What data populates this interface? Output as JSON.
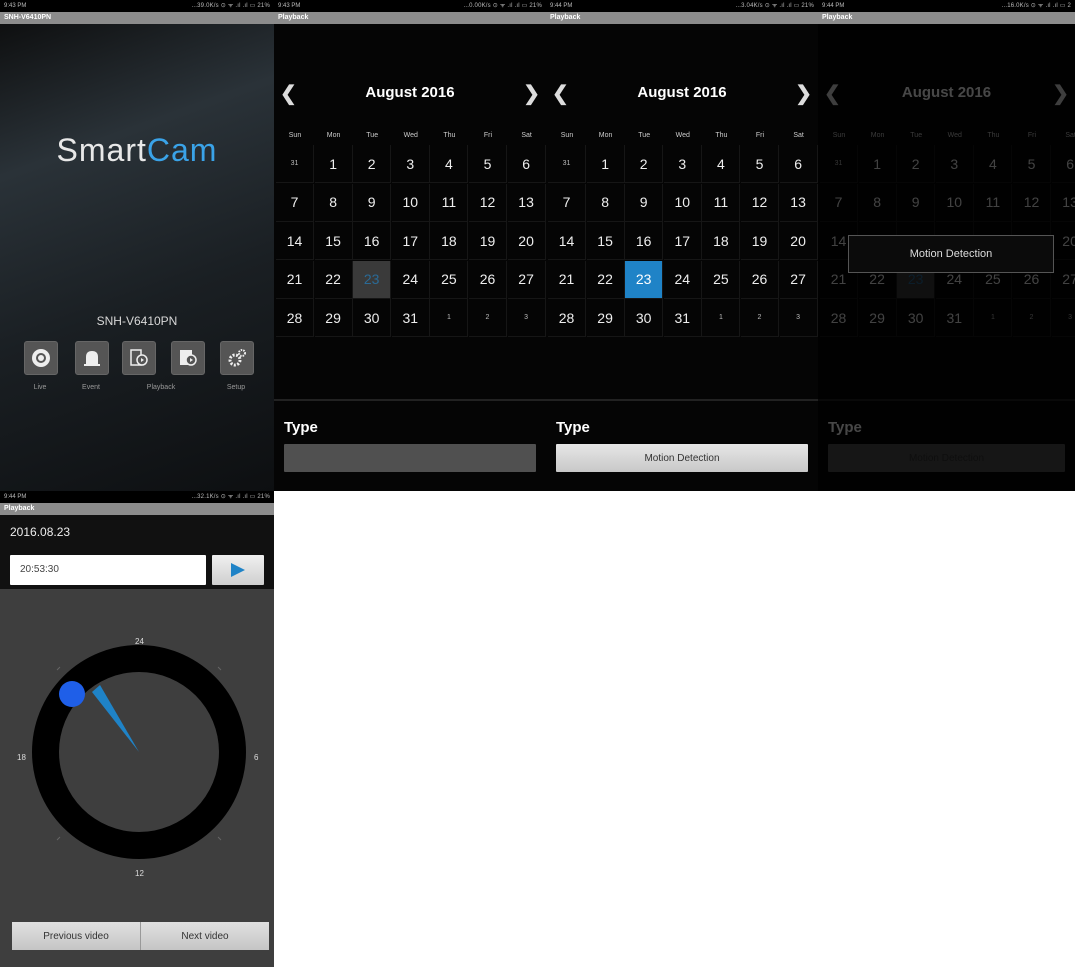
{
  "screen1": {
    "status_time": "9:43 PM",
    "status_right": "...39.0K/s ⊙ ᯤ .ıl .ıl ▭ 21%",
    "title": "SNH-V6410PN",
    "logo_smart": "Smart",
    "logo_cam": "Cam",
    "model": "SNH-V6410PN",
    "menu": [
      {
        "label": "Live",
        "icon": "live-icon"
      },
      {
        "label": "Event",
        "icon": "bell-icon"
      },
      {
        "label": "",
        "icon": "playback-icon"
      },
      {
        "label": "Playback",
        "icon": "playback-file-icon"
      },
      {
        "label": "Setup",
        "icon": "gear-icon"
      }
    ]
  },
  "calendars": [
    {
      "status_time": "9:43 PM",
      "status_right": "...0.00K/s ⊙ ᯤ .ıl .ıl ▭ 21%",
      "title": "Playback",
      "month": "August 2016",
      "selected_style": "gray",
      "type_label": "Type",
      "type_value": ""
    },
    {
      "status_time": "9:44 PM",
      "status_right": "...3.04K/s ⊙ ᯤ .ıl .ıl ▭ 21%",
      "title": "Playback",
      "month": "August 2016",
      "selected_style": "blue",
      "type_label": "Type",
      "type_value": "Motion Detection"
    },
    {
      "status_time": "9:44 PM",
      "status_right": "...16.0K/s ⊙ ᯤ .ıl .ıl ▭ 2",
      "title": "Playback",
      "month": "August 2016",
      "selected_style": "gray",
      "type_label": "Type",
      "type_value": "Motion Detection",
      "popup": "Motion Detection"
    }
  ],
  "weekdays": [
    "Sun",
    "Mon",
    "Tue",
    "Wed",
    "Thu",
    "Fri",
    "Sat"
  ],
  "weeks": [
    [
      "31",
      "1",
      "2",
      "3",
      "4",
      "5",
      "6"
    ],
    [
      "7",
      "8",
      "9",
      "10",
      "11",
      "12",
      "13"
    ],
    [
      "14",
      "15",
      "16",
      "17",
      "18",
      "19",
      "20"
    ],
    [
      "21",
      "22",
      "23",
      "24",
      "25",
      "26",
      "27"
    ],
    [
      "28",
      "29",
      "30",
      "31",
      "1",
      "2",
      "3"
    ]
  ],
  "selected_day": "23",
  "colors": {
    "accent": "#1f83c7",
    "background": "#050505"
  },
  "playback": {
    "status_time": "9:44 PM",
    "status_right": "...32.1K/s ⊙ ᯤ .ıl .ıl ▭ 21%",
    "title": "Playback",
    "date": "2016.08.23",
    "time": "20:53:30",
    "clock_labels": {
      "top": "24",
      "right": "6",
      "bottom": "12",
      "left": "18"
    },
    "prev_label": "Previous video",
    "next_label": "Next video"
  }
}
